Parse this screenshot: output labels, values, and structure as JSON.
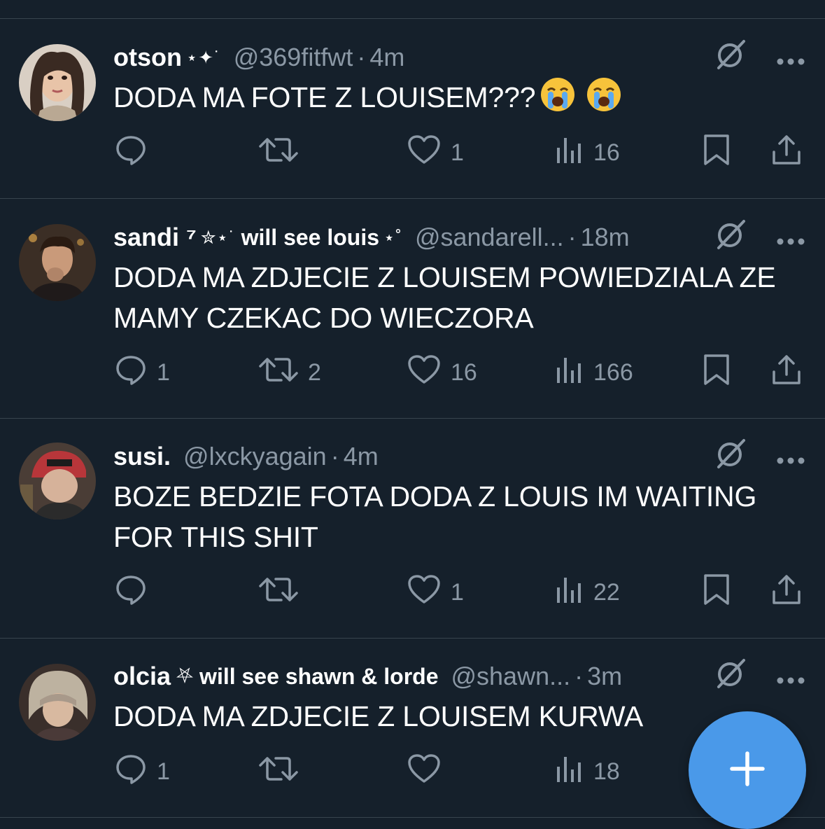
{
  "colors": {
    "background": "#15202b",
    "divider": "#38444d",
    "muted": "#8b98a5",
    "text": "#ffffff",
    "fab": "#4a99e9"
  },
  "tweets": [
    {
      "display_name": "otson",
      "name_extra": "",
      "name_decoration": "⋆✦˙",
      "handle": "@369fitfwt",
      "time": "4m",
      "text": "DODA MA FOTE Z LOUISEM???",
      "emoji": [
        "loudly-crying-face",
        "loudly-crying-face"
      ],
      "reply_count": "",
      "retweet_count": "",
      "like_count": "1",
      "view_count": "16"
    },
    {
      "display_name": "sandi ⁷",
      "name_decoration": "✮⋆˙",
      "name_extra": "will see louis",
      "name_extra_decoration": "⋆˚",
      "handle": "@sandarell...",
      "time": "18m",
      "text": "DODA MA ZDJECIE Z LOUISEM POWIEDZIALA ZE MAMY CZEKAC DO WIECZORA",
      "reply_count": "1",
      "retweet_count": "2",
      "like_count": "16",
      "view_count": "166"
    },
    {
      "display_name": "susi.",
      "name_extra": "",
      "name_decoration": "",
      "handle": "@lxckyagain",
      "time": "4m",
      "text": "BOZE BEDZIE FOTA DODA Z LOUIS IM WAITING FOR THIS SHIT",
      "reply_count": "",
      "retweet_count": "",
      "like_count": "1",
      "view_count": "22"
    },
    {
      "display_name": "olcia",
      "name_decoration": "⛧",
      "name_extra": "will see shawn & lorde",
      "handle": "@shawn...",
      "time": "3m",
      "text": "DODA MA ZDJECIE Z LOUISEM KURWA",
      "reply_count": "1",
      "retweet_count": "",
      "like_count": "",
      "view_count": "18"
    }
  ],
  "separator": "·",
  "icons": {
    "reply": "reply-icon",
    "retweet": "retweet-icon",
    "like": "heart-icon",
    "views": "views-chart-icon",
    "bookmark": "bookmark-icon",
    "share": "share-icon",
    "grok": "grok-icon",
    "more": "more-dots-icon",
    "compose": "plus-icon"
  }
}
